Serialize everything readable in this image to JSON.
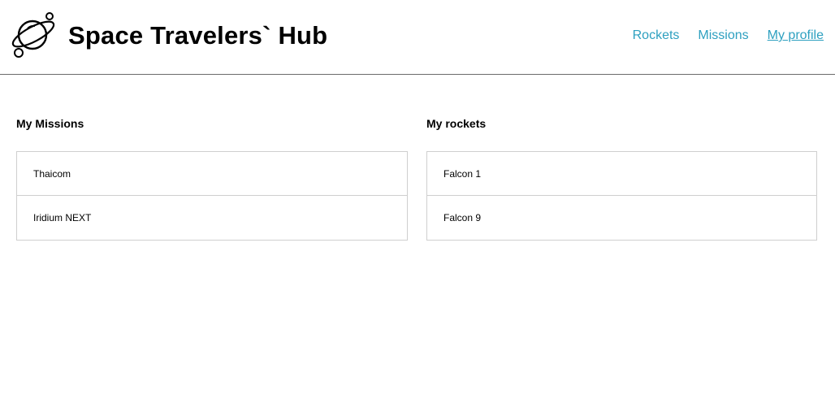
{
  "header": {
    "logo_icon": "planet-icon",
    "title": "Space Travelers` Hub",
    "nav": [
      {
        "label": "Rockets",
        "active": false
      },
      {
        "label": "Missions",
        "active": false
      },
      {
        "label": "My profile",
        "active": true
      }
    ]
  },
  "colors": {
    "link": "#2ea0c0",
    "divider": "#6b6b6b",
    "border": "#cfcfcf"
  },
  "missions": {
    "title": "My Missions",
    "items": [
      "Thaicom",
      "Iridium NEXT"
    ]
  },
  "rockets": {
    "title": "My rockets",
    "items": [
      "Falcon 1",
      "Falcon 9"
    ]
  }
}
